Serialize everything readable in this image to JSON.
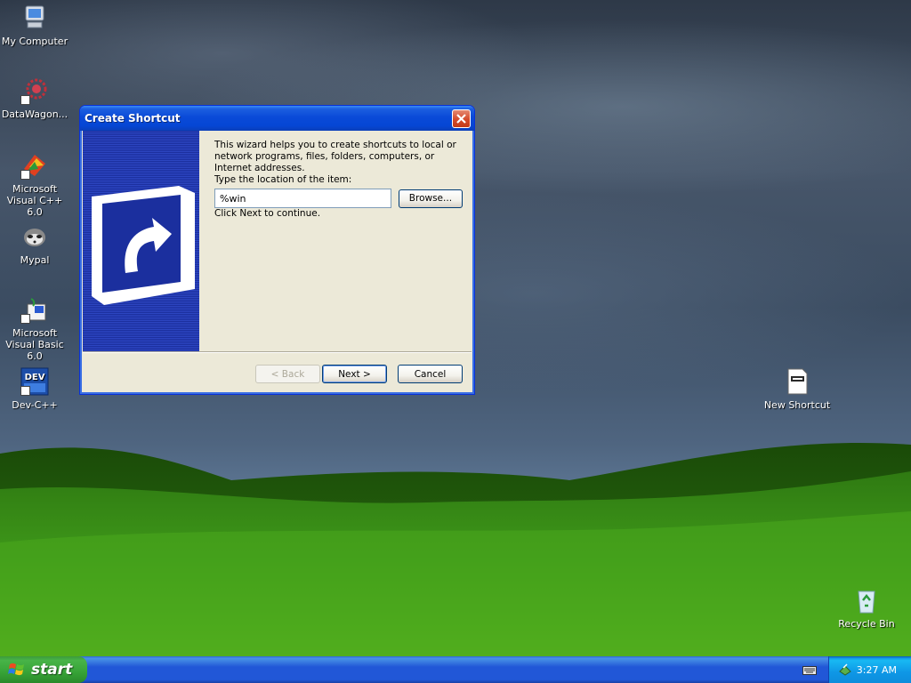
{
  "desktop": {
    "icons": [
      {
        "label": "My Computer"
      },
      {
        "label": "DataWagon..."
      },
      {
        "label": "Microsoft Visual C++ 6.0"
      },
      {
        "label": "Mypal"
      },
      {
        "label": "Microsoft Visual Basic 6.0"
      },
      {
        "label": "Dev-C++"
      },
      {
        "label": "New Shortcut"
      },
      {
        "label": "Recycle Bin"
      }
    ],
    "dev_icon_text": "DEV"
  },
  "dialog": {
    "title": "Create Shortcut",
    "intro": "This wizard helps you to create shortcuts to local or network programs, files, folders, computers, or Internet addresses.",
    "location_label": "Type the location of the item:",
    "location_value": "%win",
    "browse_label": "Browse...",
    "continue_text": "Click Next to continue.",
    "back_label": "< Back",
    "next_label": "Next >",
    "cancel_label": "Cancel"
  },
  "taskbar": {
    "start_label": "start",
    "clock": "3:27 AM"
  }
}
